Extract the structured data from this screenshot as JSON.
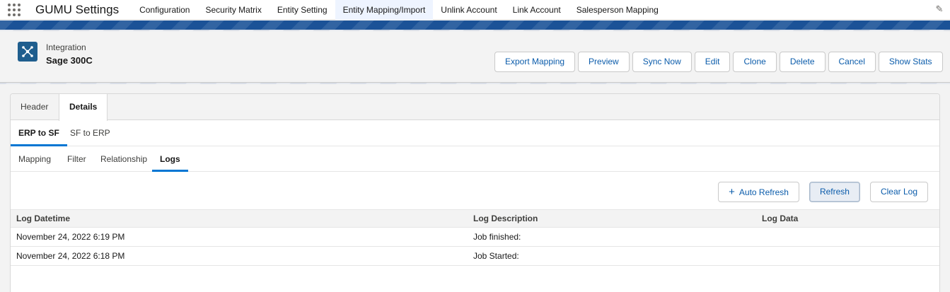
{
  "app": {
    "name": "GUMU Settings",
    "nav_items": [
      {
        "label": "Configuration"
      },
      {
        "label": "Security Matrix"
      },
      {
        "label": "Entity Setting"
      },
      {
        "label": "Entity Mapping/Import"
      },
      {
        "label": "Unlink Account"
      },
      {
        "label": "Link Account"
      },
      {
        "label": "Salesperson Mapping"
      }
    ],
    "active_nav": "Entity Mapping/Import"
  },
  "record": {
    "type": "Integration",
    "title": "Sage 300C",
    "actions": [
      {
        "label": "Export Mapping"
      },
      {
        "label": "Preview"
      },
      {
        "label": "Sync Now"
      },
      {
        "label": "Edit"
      },
      {
        "label": "Clone"
      },
      {
        "label": "Delete"
      },
      {
        "label": "Cancel"
      },
      {
        "label": "Show Stats"
      }
    ]
  },
  "tabs": {
    "level1": [
      {
        "label": "Header"
      },
      {
        "label": "Details"
      }
    ],
    "level1_active": "Details",
    "level2": [
      {
        "label": "ERP to SF"
      },
      {
        "label": "SF to ERP"
      }
    ],
    "level2_active": "ERP to SF",
    "level3": [
      {
        "label": "Mapping"
      },
      {
        "label": "Filter"
      },
      {
        "label": "Relationship"
      },
      {
        "label": "Logs"
      }
    ],
    "level3_active": "Logs"
  },
  "logs": {
    "buttons": {
      "auto_refresh": "Auto Refresh",
      "refresh": "Refresh",
      "clear_log": "Clear Log"
    },
    "columns": [
      "Log Datetime",
      "Log Description",
      "Log Data"
    ],
    "rows": [
      {
        "datetime": "November 24, 2022 6:19 PM",
        "description": "Job finished:",
        "data": ""
      },
      {
        "datetime": "November 24, 2022 6:18 PM",
        "description": "Job Started:",
        "data": ""
      }
    ]
  },
  "colors": {
    "brand": "#1b5297",
    "accent": "#0176d3",
    "link": "#0b5cab"
  }
}
